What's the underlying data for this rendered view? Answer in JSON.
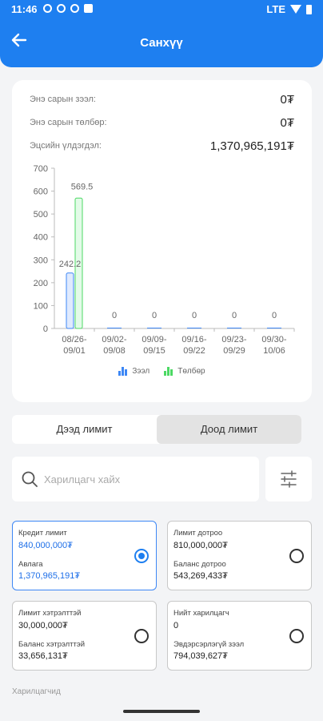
{
  "status_bar": {
    "time": "11:46",
    "network": "LTE"
  },
  "header": {
    "title": "Санхүү"
  },
  "summary": {
    "rows": [
      {
        "label": "Энэ сарын зээл:",
        "value": "0₮"
      },
      {
        "label": "Энэ сарын төлбөр:",
        "value": "0₮"
      },
      {
        "label": "Эцсийн үлдэгдэл:",
        "value": "1,370,965,191₮"
      }
    ]
  },
  "chart_data": {
    "type": "bar",
    "categories": [
      "08/26-09/01",
      "09/02-09/08",
      "09/09-09/15",
      "09/16-09/22",
      "09/23-09/29",
      "09/30-10/06"
    ],
    "category_lines": [
      [
        "08/26-",
        "09/01"
      ],
      [
        "09/02-",
        "09/08"
      ],
      [
        "09/09-",
        "09/15"
      ],
      [
        "09/16-",
        "09/22"
      ],
      [
        "09/23-",
        "09/29"
      ],
      [
        "09/30-",
        "10/06"
      ]
    ],
    "series": [
      {
        "name": "Зээл",
        "values": [
          242.2,
          0,
          0,
          0,
          0,
          0
        ],
        "color": "#3d87f5"
      },
      {
        "name": "Төлбөр",
        "values": [
          569.5,
          0,
          0,
          0,
          0,
          0
        ],
        "color": "#4cd964"
      }
    ],
    "value_labels": [
      "242.2",
      "569.5",
      "0",
      "0",
      "0",
      "0",
      "0"
    ],
    "ylim": [
      0,
      700
    ],
    "yticks": [
      0,
      100,
      200,
      300,
      400,
      500,
      600,
      700
    ],
    "grid": false,
    "legend": "bottom"
  },
  "tabs": [
    {
      "label": "Дээд лимит",
      "active": false
    },
    {
      "label": "Доод лимит",
      "active": true
    }
  ],
  "search": {
    "placeholder": "Харилцагч хайх"
  },
  "stats": [
    {
      "label1": "Кредит лимит",
      "value1": "840,000,000₮",
      "label2": "Авлага",
      "value2": "1,370,965,191₮",
      "selected": true
    },
    {
      "label1": "Лимит дотроо",
      "value1": "810,000,000₮",
      "label2": "Баланс дотроо",
      "value2": "543,269,433₮",
      "selected": false
    },
    {
      "label1": "Лимит хэтрэлттэй",
      "value1": "30,000,000₮",
      "label2": "Баланс хэтрэлттэй",
      "value2": "33,656,131₮",
      "selected": false
    },
    {
      "label1": "Нийт харилцагч",
      "value1": "0",
      "label2": "Эвдэрсэрлэгүй зээл",
      "value2": "794,039,627₮",
      "selected": false
    }
  ],
  "cut_off_text": "Харилцагчид"
}
